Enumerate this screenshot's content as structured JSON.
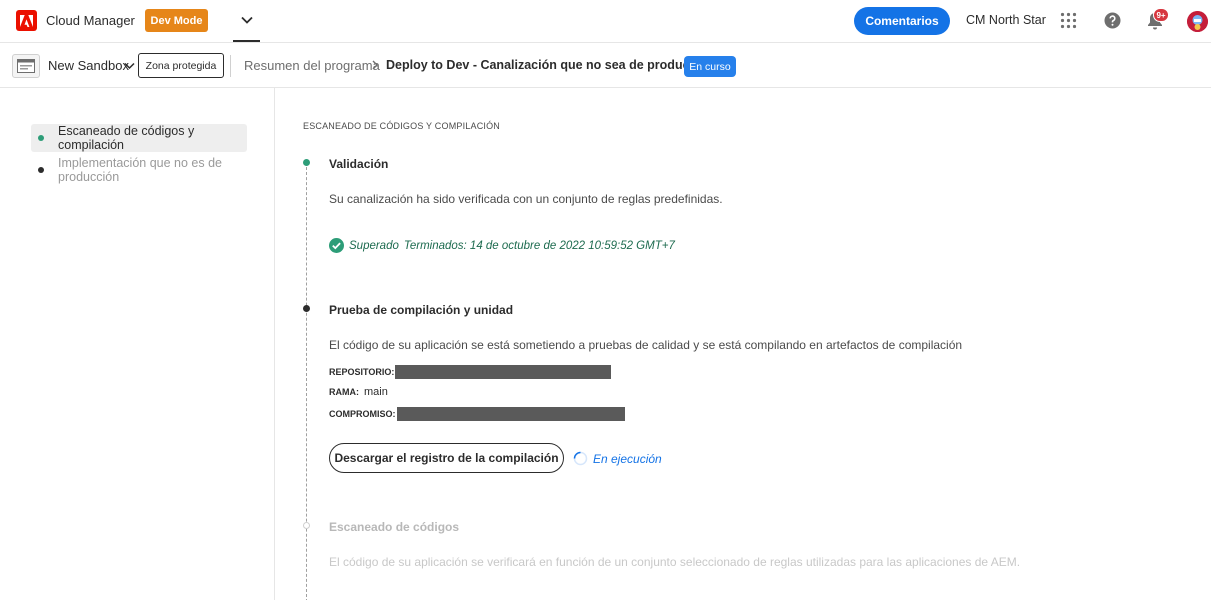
{
  "header": {
    "app_name": "Cloud Manager",
    "mode_badge": "Dev Mode",
    "feedback_label": "Comentarios",
    "org_name": "CM North Star",
    "notification_count": "9+"
  },
  "subbar": {
    "sandbox_name": "New Sandbox",
    "zone_label": "Zona protegida",
    "breadcrumb_root": "Resumen del programa",
    "breadcrumb_current": "Deploy to Dev - Canalización que no sea de producción",
    "status": "En curso"
  },
  "sidebar": {
    "items": [
      {
        "label": "Escaneado de códigos y compilación"
      },
      {
        "label": "Implementación que no es de producción"
      }
    ]
  },
  "main": {
    "section_title": "ESCANEADO DE CÓDIGOS Y COMPILACIÓN",
    "steps": [
      {
        "title": "Validación",
        "description": "Su canalización ha sido verificada con un conjunto de reglas predefinidas.",
        "result_status": "Superado",
        "result_time": "Terminados: 14 de octubre de 2022 10:59:52 GMT+7"
      },
      {
        "title": "Prueba de compilación y unidad",
        "description": "El código de su aplicación se está sometiendo a pruebas de calidad y se está compilando en artefactos de compilación",
        "repo_label": "REPOSITORIO:",
        "branch_label": "RAMA:",
        "branch_value": "main",
        "commit_label": "COMPROMISO:",
        "download_label": "Descargar el registro de la compilación",
        "running_label": "En ejecución"
      },
      {
        "title": "Escaneado de códigos",
        "description": "El código de su aplicación se verificará en función de un conjunto seleccionado de reglas utilizadas para las aplicaciones de AEM."
      }
    ]
  },
  "colors": {
    "accent": "#1473e6",
    "success": "#2d9d78",
    "dev_mode": "#e68619",
    "status_pill": "#2680eb"
  }
}
